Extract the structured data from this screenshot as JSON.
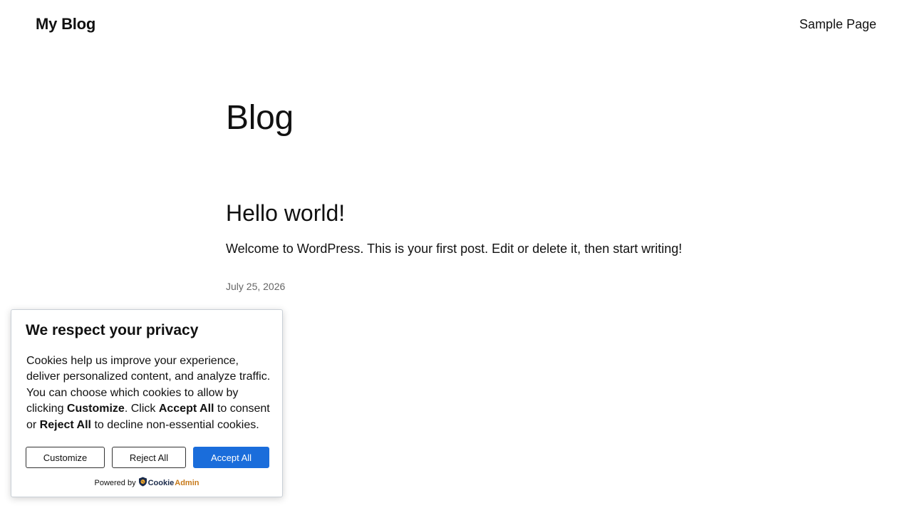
{
  "header": {
    "site_title": "My Blog",
    "nav": [
      "Sample Page"
    ]
  },
  "main": {
    "page_heading": "Blog",
    "posts": [
      {
        "title": "Hello world!",
        "excerpt": "Welcome to WordPress. This is your first post. Edit or delete it, then start writing!",
        "date": "July 25, 2026"
      }
    ]
  },
  "cookie_banner": {
    "title": "We respect your privacy",
    "text_parts": [
      "Cookies help us improve your experience, deliver personalized content, and analyze traffic. You can choose which cookies to allow by clicking ",
      "Customize",
      ". Click ",
      "Accept All",
      " to consent or ",
      "Reject All",
      " to decline non-essential cookies."
    ],
    "buttons": {
      "customize": "Customize",
      "reject": "Reject All",
      "accept": "Accept All"
    },
    "powered_by": "Powered by",
    "brand_part1": "Cookie",
    "brand_part2": "Admin",
    "brand_icon": "shield-icon",
    "accent_color": "#1a6ddb"
  }
}
